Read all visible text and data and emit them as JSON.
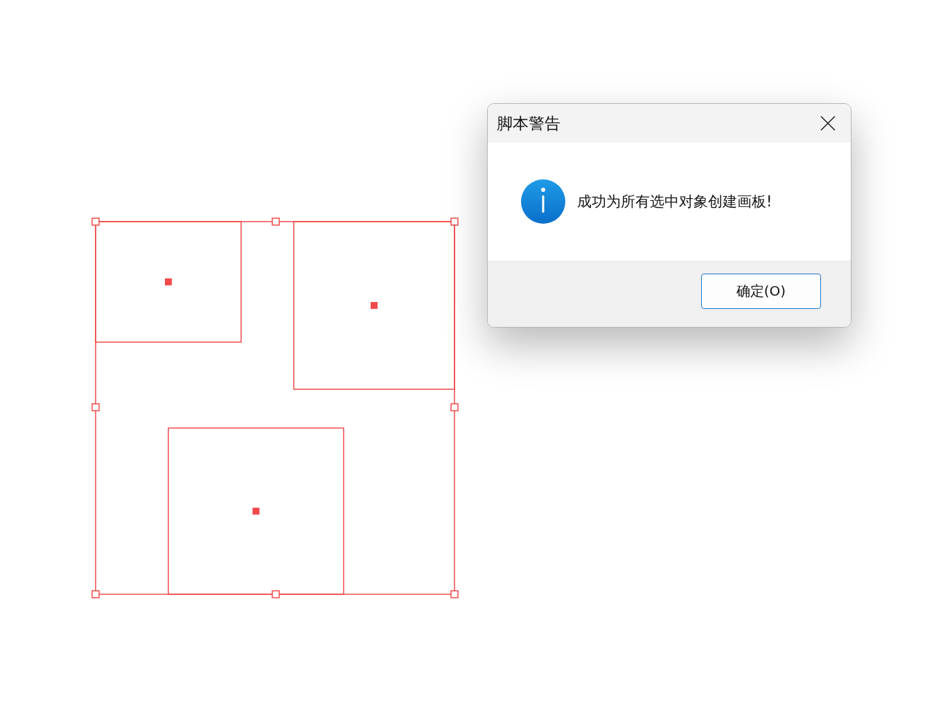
{
  "dialog": {
    "title": "脚本警告",
    "message": "成功为所有选中对象创建画板!",
    "buttons": [
      {
        "label": "确定(O)",
        "default": true
      }
    ]
  }
}
